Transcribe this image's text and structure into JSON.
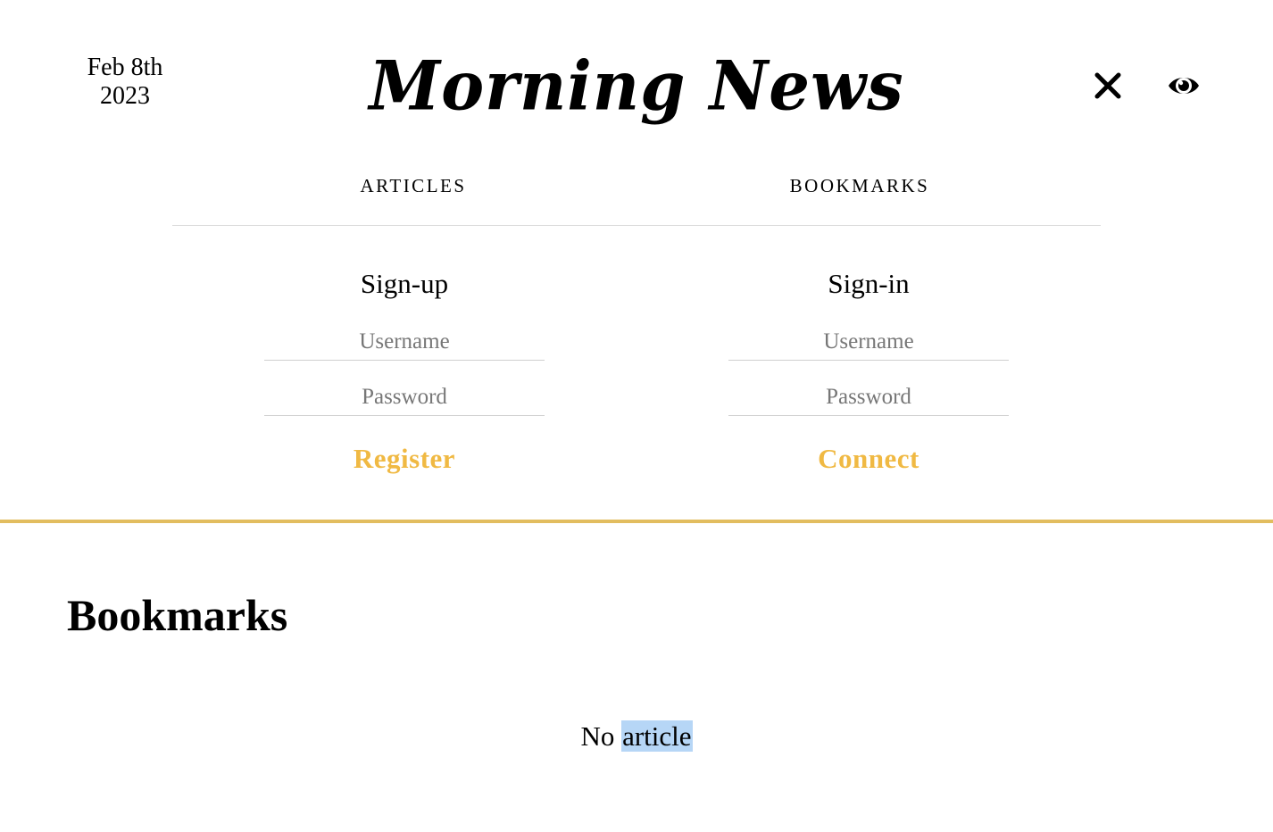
{
  "header": {
    "date_line1": "Feb 8th",
    "date_line2": "2023",
    "logo": "Morning News",
    "close_icon": "close-icon",
    "eye_icon": "eye-icon"
  },
  "nav": {
    "articles": "ARTICLES",
    "bookmarks": "BOOKMARKS"
  },
  "signup": {
    "title": "Sign-up",
    "username_placeholder": "Username",
    "password_placeholder": "Password",
    "action": "Register"
  },
  "signin": {
    "title": "Sign-in",
    "username_placeholder": "Username",
    "password_placeholder": "Password",
    "action": "Connect"
  },
  "bookmarks": {
    "title": "Bookmarks",
    "empty_word1": "No",
    "empty_word2": "article"
  },
  "colors": {
    "accent": "#f0b943",
    "divider": "#e2bd5f",
    "selection": "#b6d6f6"
  }
}
